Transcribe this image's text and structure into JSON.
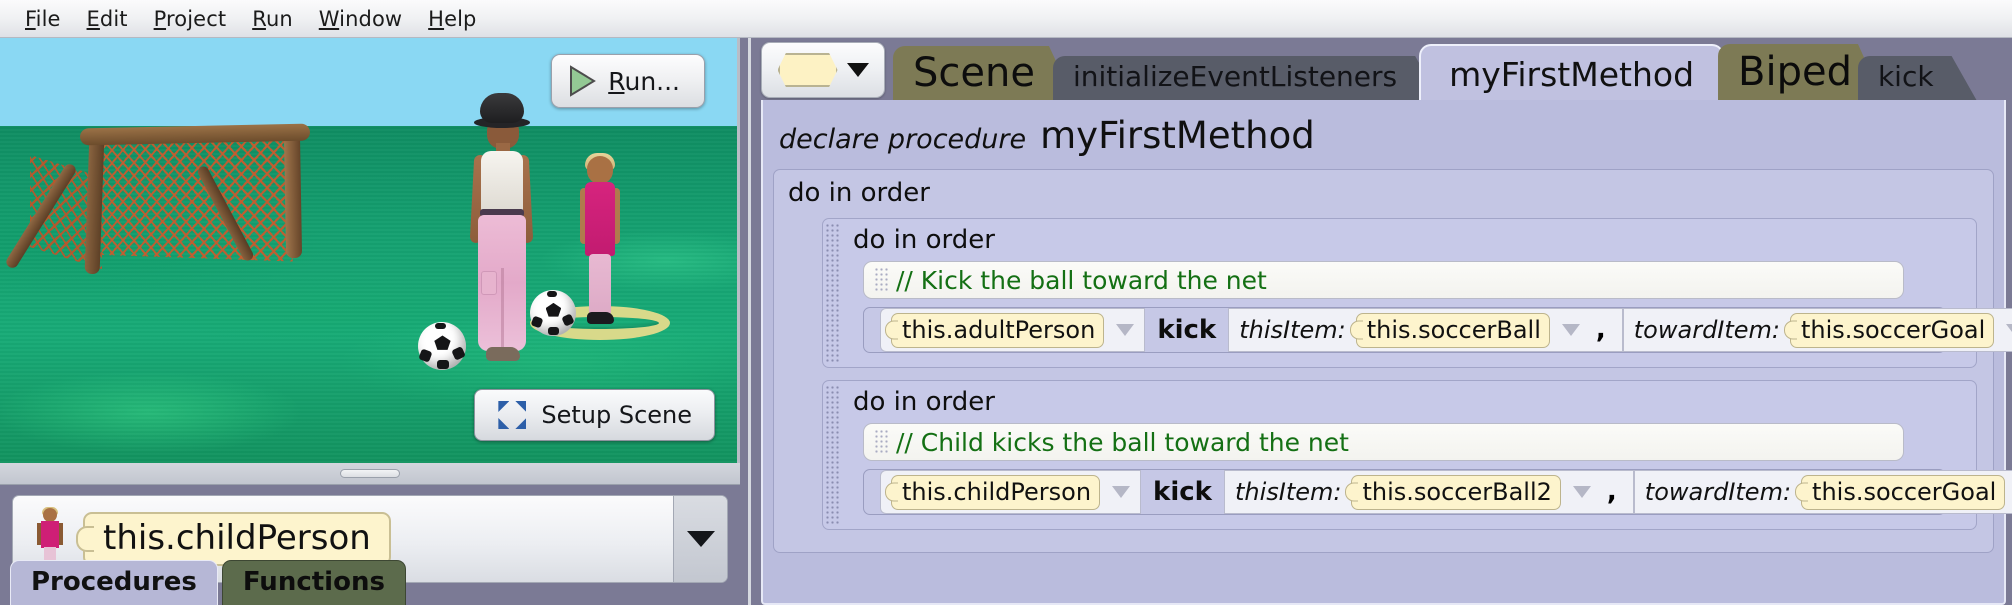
{
  "menu": {
    "items": [
      {
        "label": "File",
        "mnemonic": "F"
      },
      {
        "label": "Edit",
        "mnemonic": "E"
      },
      {
        "label": "Project",
        "mnemonic": "P"
      },
      {
        "label": "Run",
        "mnemonic": "R"
      },
      {
        "label": "Window",
        "mnemonic": "W"
      },
      {
        "label": "Help",
        "mnemonic": "H"
      }
    ]
  },
  "scene": {
    "run_button": "Run...",
    "run_mnemonic": "R",
    "setup_button": "Setup Scene",
    "sky_color": "#8ad8f3",
    "ground_color": "#14a070"
  },
  "object_selector": {
    "selected": "this.childPerson",
    "dropdown_icon": "chevron-down-icon",
    "thumbnail_icon": "child-person-thumbnail"
  },
  "bottom_tabs": [
    {
      "label": "Procedures",
      "selected": true
    },
    {
      "label": "Functions",
      "selected": false
    }
  ],
  "editor": {
    "picker_icon": "hexagon-tile-icon",
    "picker_caret": "chevron-down-icon",
    "tabs": [
      {
        "label": "Scene",
        "style": "class",
        "selected": false
      },
      {
        "label": "initializeEventListeners",
        "style": "method",
        "selected": false
      },
      {
        "label": "myFirstMethod",
        "style": "method",
        "selected": true
      },
      {
        "label": "Biped",
        "style": "class",
        "selected": false
      },
      {
        "label": "kick",
        "style": "method",
        "selected": false
      }
    ],
    "declare_keyword": "declare procedure",
    "declare_name": "myFirstMethod",
    "outer_block_label": "do in order",
    "groups": [
      {
        "label": "do in order",
        "comment": "// Kick the ball toward the net",
        "statement": {
          "target": "this.adultPerson",
          "method": "kick",
          "params": [
            {
              "name": "thisItem:",
              "value": "this.soccerBall"
            },
            {
              "name": "towardItem:",
              "value": "this.soccerGoal"
            }
          ],
          "separator": ","
        }
      },
      {
        "label": "do in order",
        "comment": "// Child kicks the ball toward the net",
        "statement": {
          "target": "this.childPerson",
          "method": "kick",
          "params": [
            {
              "name": "thisItem:",
              "value": "this.soccerBall2"
            },
            {
              "name": "towardItem:",
              "value": "this.soccerGoal"
            }
          ],
          "separator": ","
        }
      }
    ]
  },
  "colors": {
    "tile_yellow": "#fdf4cd",
    "comment_green": "#147014",
    "panel_purple": "#7b7a95",
    "editor_lilac": "#babcdd",
    "class_tab_olive": "#7d7a55",
    "active_tab": "#c0c1e0"
  }
}
